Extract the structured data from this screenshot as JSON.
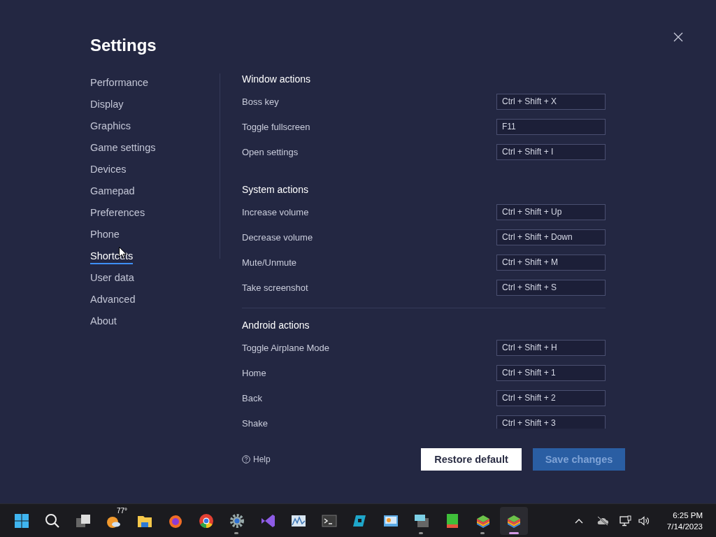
{
  "settings": {
    "title": "Settings",
    "nav": [
      {
        "label": "Performance",
        "selected": false
      },
      {
        "label": "Display",
        "selected": false
      },
      {
        "label": "Graphics",
        "selected": false
      },
      {
        "label": "Game settings",
        "selected": false
      },
      {
        "label": "Devices",
        "selected": false
      },
      {
        "label": "Gamepad",
        "selected": false
      },
      {
        "label": "Preferences",
        "selected": false
      },
      {
        "label": "Phone",
        "selected": false
      },
      {
        "label": "Shortcuts",
        "selected": true
      },
      {
        "label": "User data",
        "selected": false
      },
      {
        "label": "Advanced",
        "selected": false
      },
      {
        "label": "About",
        "selected": false
      }
    ],
    "sections": [
      {
        "heading": "Window actions",
        "separated": false,
        "rows": [
          {
            "label": "Boss key",
            "value": "Ctrl + Shift + X"
          },
          {
            "label": "Toggle fullscreen",
            "value": "F11"
          },
          {
            "label": "Open settings",
            "value": "Ctrl + Shift + I"
          }
        ]
      },
      {
        "heading": "System actions",
        "separated": false,
        "rows": [
          {
            "label": "Increase volume",
            "value": "Ctrl + Shift + Up"
          },
          {
            "label": "Decrease volume",
            "value": "Ctrl + Shift + Down"
          },
          {
            "label": "Mute/Unmute",
            "value": "Ctrl + Shift + M"
          },
          {
            "label": "Take screenshot",
            "value": "Ctrl + Shift + S"
          }
        ]
      },
      {
        "heading": "Android actions",
        "separated": true,
        "rows": [
          {
            "label": "Toggle Airplane Mode",
            "value": "Ctrl + Shift + H"
          },
          {
            "label": "Home",
            "value": "Ctrl + Shift + 1"
          },
          {
            "label": "Back",
            "value": "Ctrl + Shift + 2"
          },
          {
            "label": "Shake",
            "value": "Ctrl + Shift + 3"
          }
        ]
      }
    ],
    "help": "Help",
    "buttons": [
      {
        "label": "Restore default",
        "kind": "secondary"
      },
      {
        "label": "Save changes",
        "kind": "primary"
      }
    ]
  },
  "taskbar": {
    "apps": [
      {
        "running": false,
        "selected": false
      },
      {
        "running": false,
        "selected": false
      },
      {
        "running": false,
        "selected": false
      },
      {
        "running": false,
        "selected": false,
        "badge": "77°"
      },
      {
        "running": false,
        "selected": false
      },
      {
        "running": false,
        "selected": false
      },
      {
        "running": false,
        "selected": false
      },
      {
        "running": true,
        "selected": false
      },
      {
        "running": false,
        "selected": false
      },
      {
        "running": false,
        "selected": false
      },
      {
        "running": false,
        "selected": false
      },
      {
        "running": false,
        "selected": false
      },
      {
        "running": false,
        "selected": false
      },
      {
        "running": true,
        "selected": false
      },
      {
        "running": false,
        "selected": false
      },
      {
        "running": true,
        "selected": false
      },
      {
        "running": true,
        "selected": true
      }
    ],
    "time": "6:25 PM",
    "date": "7/14/2023"
  }
}
